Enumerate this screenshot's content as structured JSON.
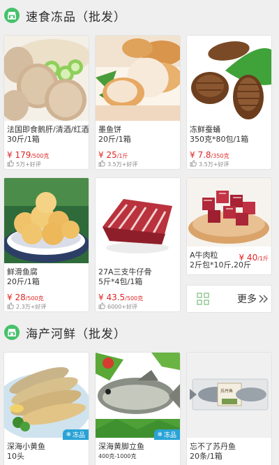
{
  "colors": {
    "accent": "#46c16b",
    "price": "#e02424",
    "badge": "#2aa3d6"
  },
  "sections": [
    {
      "title": "速食冻品（批发）",
      "icon": "shop-icon"
    },
    {
      "title": "海产河鲜（批发）",
      "icon": "shop-icon"
    }
  ],
  "frozen": [
    {
      "name": "法国即食鹅肝/清酒/红酒",
      "spec": "30斤/1箱",
      "price": "¥ 179",
      "unit": "/500克",
      "reviews": "5万+好评"
    },
    {
      "name": "墨鱼饼",
      "spec": "20斤/1箱",
      "price": "¥ 25",
      "unit": "/1斤",
      "reviews": "3.5万+好评"
    },
    {
      "name": "冻鲜蚕蛹",
      "spec": "350克*80包/1箱",
      "price": "¥ 7.8",
      "unit": "/350克",
      "reviews": "3.5万+好评"
    },
    {
      "name": "鲜滑鱼腐",
      "spec": "20斤/1箱",
      "price": "¥ 28",
      "unit": "/500克",
      "reviews": "2.3万+好评"
    },
    {
      "name": "27A三支牛仔骨",
      "spec": "5斤*4包/1箱",
      "price": "¥ 43.5",
      "unit": "/500克",
      "reviews": "6000+好评"
    },
    {
      "name": "A牛肉粒",
      "spec": "2斤包*10斤,20斤",
      "price": "¥ 40",
      "unit": "/1斤"
    }
  ],
  "more": {
    "label": "更多",
    "grid_icon": "grid-icon",
    "arrow_icon": "double-chevron-right-icon"
  },
  "seafood": [
    {
      "name": "深海小黄鱼",
      "spec": "10头",
      "badge": "冻品"
    },
    {
      "name": "深海黄脚立鱼",
      "spec": "400克-1000克",
      "badge": "冻品"
    },
    {
      "name": "忘不了苏丹鱼",
      "spec": "20条/1箱",
      "package_text": "苏丹鱼"
    }
  ]
}
